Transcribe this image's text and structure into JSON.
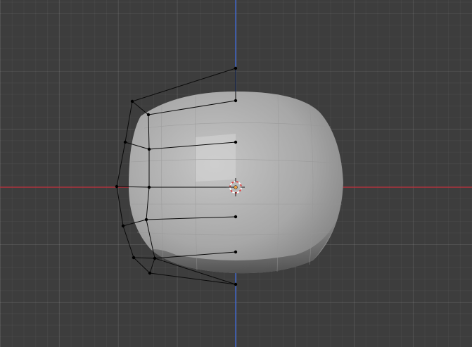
{
  "viewport": {
    "view": "front-orthographic",
    "mode": "edit",
    "colors": {
      "background": "#3d3d3d",
      "grid_line": "#4a4a4a",
      "x_axis": "#b0323c",
      "z_axis": "#3d64c8",
      "mesh_face": "#a9a9a9",
      "mesh_highlight": "#c8c8c8",
      "mesh_shadow": "#5e5e5e",
      "cage_edge": "#0a0a0a",
      "cage_vertex": "#000000",
      "cursor_red": "#e04040",
      "cursor_white": "#ffffff"
    }
  },
  "icons": {
    "cursor": "3d-cursor-icon",
    "origin": "object-origin-icon"
  }
}
